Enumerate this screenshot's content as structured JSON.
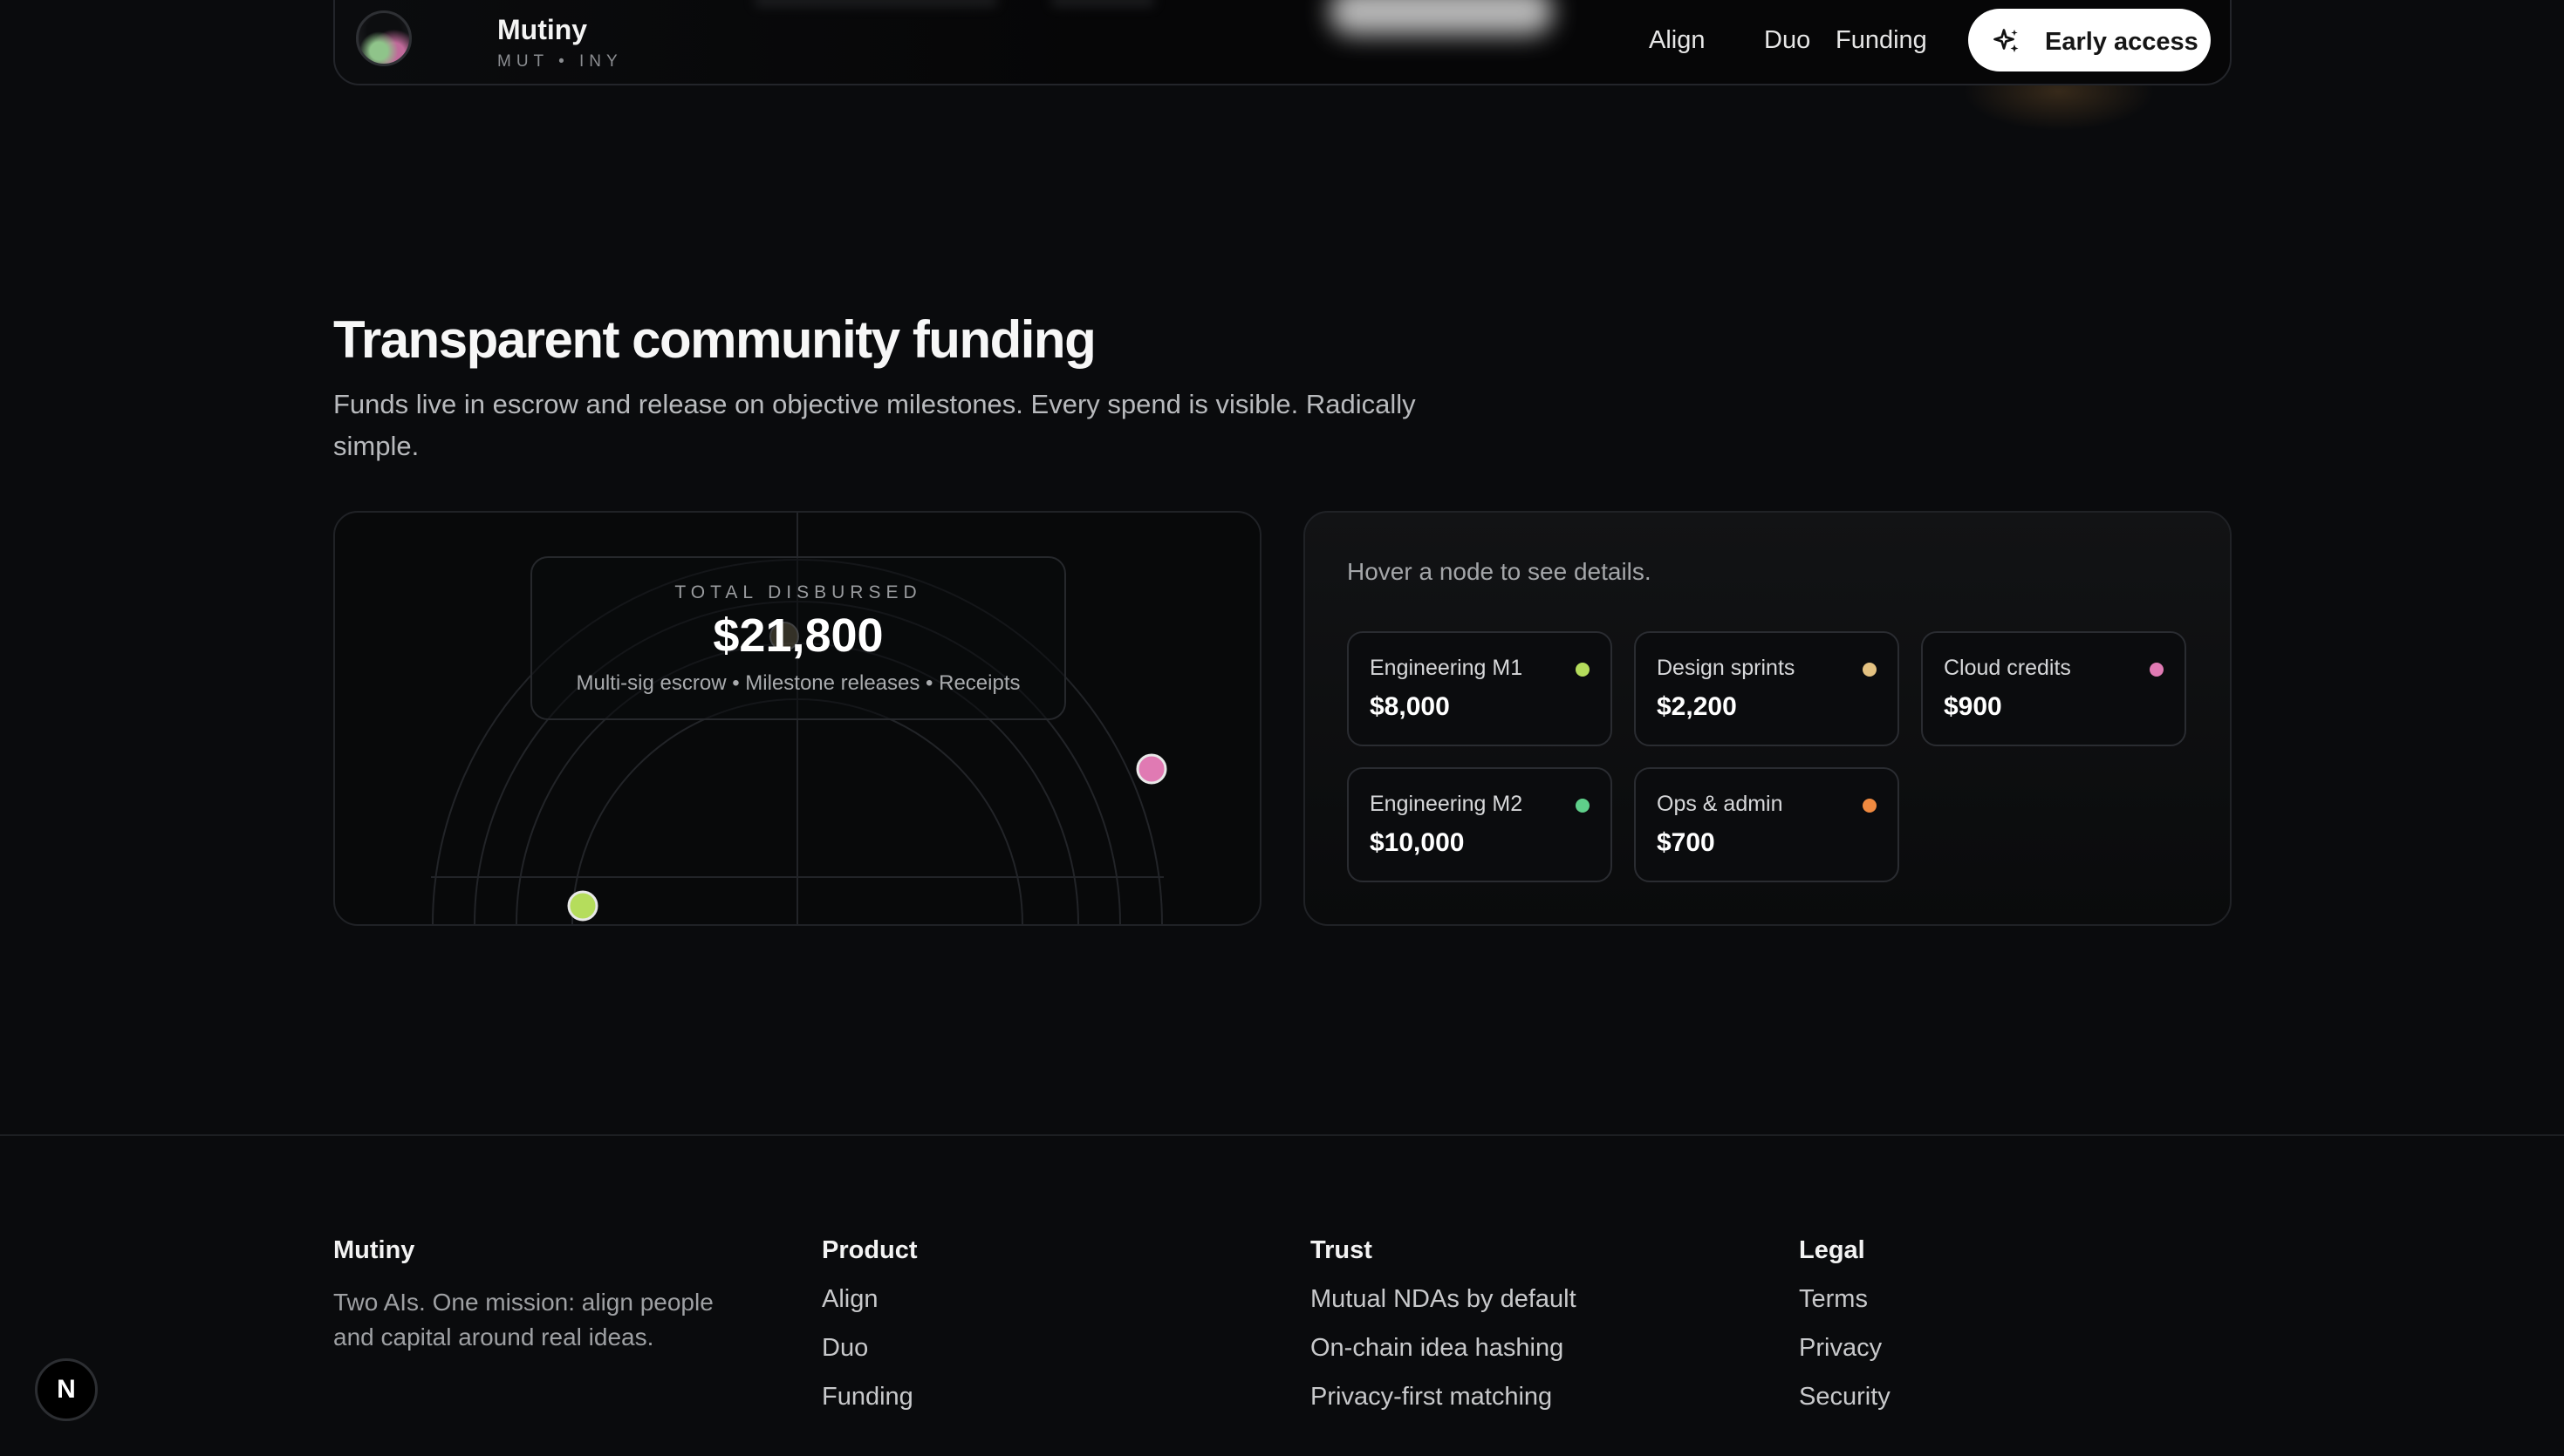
{
  "header": {
    "brand": "Mutiny",
    "brand_sub": "MUT • INY",
    "nav": [
      {
        "label": "Align"
      },
      {
        "label": "Duo"
      },
      {
        "label": "Funding"
      }
    ],
    "cta_label": "Early access",
    "cta_icon": "sparkles-icon"
  },
  "hero": {
    "title": "Transparent community funding",
    "subtitle": "Funds live in escrow and release on objective milestones. Every spend is visible. Radically simple."
  },
  "viz": {
    "total_label": "TOTAL DISBURSED",
    "total_value": "$21,800",
    "total_meta": "Multi-sig escrow • Milestone releases • Receipts",
    "node_colors": [
      "#b5dd5c",
      "#e07ab3",
      "#b7a77a"
    ]
  },
  "details": {
    "hint": "Hover a node to see details.",
    "tiles": [
      {
        "name": "Engineering M1",
        "amount": "$8,000",
        "color": "#b5dd5c"
      },
      {
        "name": "Design sprints",
        "amount": "$2,200",
        "color": "#e4c281"
      },
      {
        "name": "Cloud credits",
        "amount": "$900",
        "color": "#e07ab3"
      },
      {
        "name": "Engineering M2",
        "amount": "$10,000",
        "color": "#5fcf8a"
      },
      {
        "name": "Ops & admin",
        "amount": "$700",
        "color": "#f08a40"
      }
    ]
  },
  "footer": {
    "brand": "Mutiny",
    "tagline": "Two AIs. One mission: align people and capital around real ideas.",
    "columns": [
      {
        "title": "Product",
        "links": [
          "Align",
          "Duo",
          "Funding"
        ]
      },
      {
        "title": "Trust",
        "links": [
          "Mutual NDAs by default",
          "On-chain idea hashing",
          "Privacy-first matching"
        ]
      },
      {
        "title": "Legal",
        "links": [
          "Terms",
          "Privacy",
          "Security"
        ]
      }
    ]
  },
  "badge": "N"
}
